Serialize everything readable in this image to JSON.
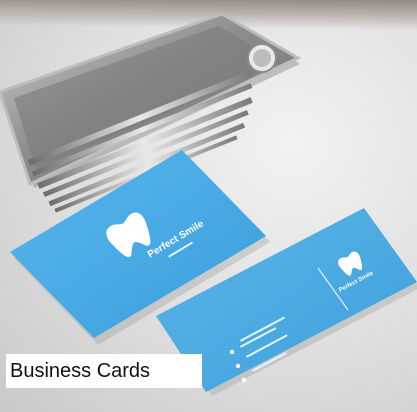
{
  "caption": {
    "text": "Business Cards"
  },
  "card_front": {
    "brand": "Perfect Smile",
    "color": "#46a9e6"
  },
  "card_back": {
    "brand": "Perfect Smile",
    "color": "#4aa9e3"
  },
  "scene": {
    "background_color": "#e2e2e2",
    "tray_color": "#8f8f8f"
  }
}
